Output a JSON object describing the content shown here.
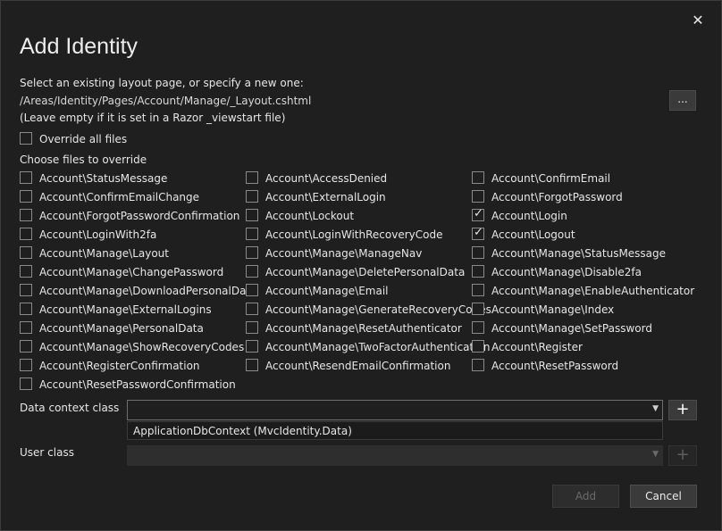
{
  "dialog": {
    "title": "Add Identity",
    "close_icon": "close-icon"
  },
  "layout": {
    "label": "Select an existing layout page, or specify a new one:",
    "path": "/Areas/Identity/Pages/Account/Manage/_Layout.cshtml",
    "hint": "(Leave empty if it is set in a Razor _viewstart file)",
    "browse_label": "..."
  },
  "override_all": {
    "label": "Override all files",
    "checked": false
  },
  "choose_label": "Choose files to override",
  "files": {
    "col1": [
      {
        "label": "Account\\StatusMessage",
        "checked": false
      },
      {
        "label": "Account\\ConfirmEmailChange",
        "checked": false
      },
      {
        "label": "Account\\ForgotPasswordConfirmation",
        "checked": false
      },
      {
        "label": "Account\\LoginWith2fa",
        "checked": false
      },
      {
        "label": "Account\\Manage\\Layout",
        "checked": false
      },
      {
        "label": "Account\\Manage\\ChangePassword",
        "checked": false
      },
      {
        "label": "Account\\Manage\\DownloadPersonalData",
        "checked": false
      },
      {
        "label": "Account\\Manage\\ExternalLogins",
        "checked": false
      },
      {
        "label": "Account\\Manage\\PersonalData",
        "checked": false
      },
      {
        "label": "Account\\Manage\\ShowRecoveryCodes",
        "checked": false
      },
      {
        "label": "Account\\RegisterConfirmation",
        "checked": false
      },
      {
        "label": "Account\\ResetPasswordConfirmation",
        "checked": false
      }
    ],
    "col2": [
      {
        "label": "Account\\AccessDenied",
        "checked": false
      },
      {
        "label": "Account\\ExternalLogin",
        "checked": false
      },
      {
        "label": "Account\\Lockout",
        "checked": false
      },
      {
        "label": "Account\\LoginWithRecoveryCode",
        "checked": false
      },
      {
        "label": "Account\\Manage\\ManageNav",
        "checked": false
      },
      {
        "label": "Account\\Manage\\DeletePersonalData",
        "checked": false
      },
      {
        "label": "Account\\Manage\\Email",
        "checked": false
      },
      {
        "label": "Account\\Manage\\GenerateRecoveryCodes",
        "checked": false
      },
      {
        "label": "Account\\Manage\\ResetAuthenticator",
        "checked": false
      },
      {
        "label": "Account\\Manage\\TwoFactorAuthentication",
        "checked": false
      },
      {
        "label": "Account\\ResendEmailConfirmation",
        "checked": false
      }
    ],
    "col3": [
      {
        "label": "Account\\ConfirmEmail",
        "checked": false
      },
      {
        "label": "Account\\ForgotPassword",
        "checked": false
      },
      {
        "label": "Account\\Login",
        "checked": true
      },
      {
        "label": "Account\\Logout",
        "checked": true
      },
      {
        "label": "Account\\Manage\\StatusMessage",
        "checked": false
      },
      {
        "label": "Account\\Manage\\Disable2fa",
        "checked": false
      },
      {
        "label": "Account\\Manage\\EnableAuthenticator",
        "checked": false
      },
      {
        "label": "Account\\Manage\\Index",
        "checked": false
      },
      {
        "label": "Account\\Manage\\SetPassword",
        "checked": false
      },
      {
        "label": "Account\\Register",
        "checked": false
      },
      {
        "label": "Account\\ResetPassword",
        "checked": false
      }
    ]
  },
  "data_context": {
    "label": "Data context class",
    "value": "",
    "dropdown_option": "ApplicationDbContext (MvcIdentity.Data)",
    "add_label": "+"
  },
  "user_class": {
    "label": "User class",
    "value": "",
    "add_label": "+"
  },
  "footer": {
    "add_label": "Add",
    "cancel_label": "Cancel"
  }
}
